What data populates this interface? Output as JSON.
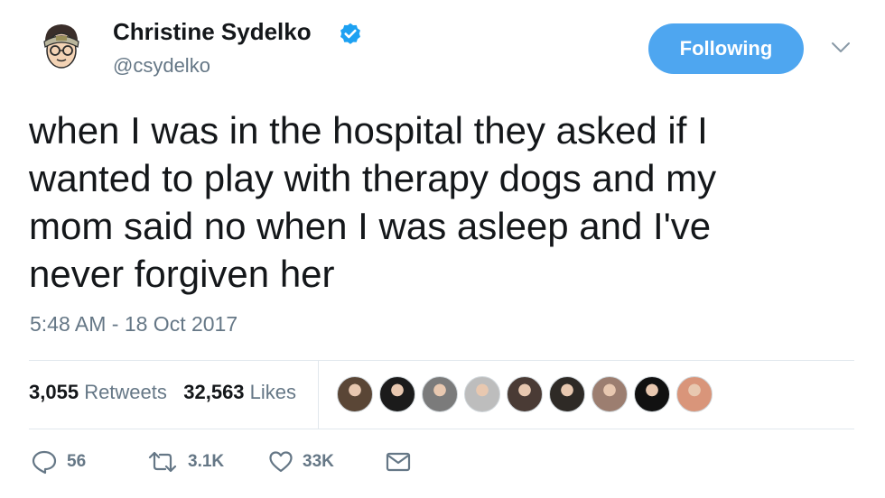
{
  "author": {
    "name": "Christine Sydelko",
    "handle": "@csydelko",
    "verified": true,
    "avatar_icon": "cartoon-avatar-icon"
  },
  "follow_button": {
    "label": "Following",
    "color": "#4ea6f0"
  },
  "tweet": {
    "lines": [
      "when I was in the hospital they asked if I",
      "wanted to play with therapy dogs and my",
      "mom said no when I was asleep and I've",
      "never forgiven her"
    ],
    "timestamp": "5:48 AM - 18 Oct 2017"
  },
  "stats": {
    "retweets_count": "3,055",
    "retweets_label": "Retweets",
    "likes_count": "32,563",
    "likes_label": "Likes"
  },
  "likers": [
    {
      "color": "#5a4636"
    },
    {
      "color": "#1b1b1b"
    },
    {
      "color": "#7b7b7b"
    },
    {
      "color": "#bdbdbd"
    },
    {
      "color": "#4a3b35"
    },
    {
      "color": "#2e2a26"
    },
    {
      "color": "#9c7e70"
    },
    {
      "color": "#111111"
    },
    {
      "color": "#d9957a"
    }
  ],
  "actions": {
    "reply_count": "56",
    "retweet_count": "3.1K",
    "like_count": "33K"
  },
  "colors": {
    "text_primary": "#14171a",
    "text_secondary": "#657786",
    "verified_blue": "#1da1f2",
    "divider": "#e1e8ed"
  }
}
